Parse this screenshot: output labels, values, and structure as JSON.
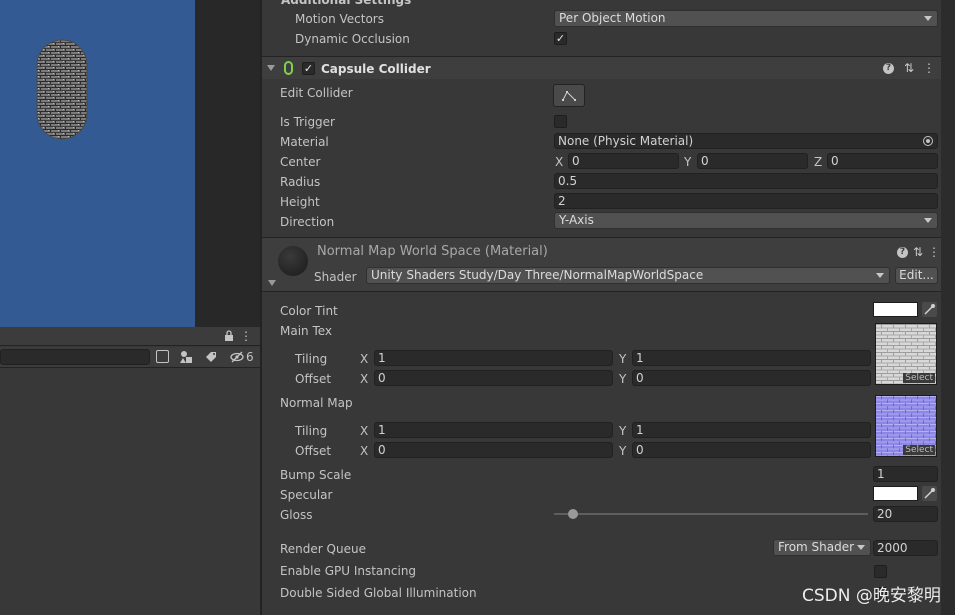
{
  "scene": {
    "bg": "#345a93"
  },
  "hierarchy": {
    "count": "6"
  },
  "additional_settings": {
    "header": "Additional Settings",
    "motion_vectors_label": "Motion Vectors",
    "motion_vectors_value": "Per Object Motion",
    "dynamic_occlusion_label": "Dynamic Occlusion",
    "dynamic_occlusion_checked": "✓"
  },
  "capsule": {
    "title": "Capsule Collider",
    "enabled": "✓",
    "edit_collider_label": "Edit Collider",
    "is_trigger_label": "Is Trigger",
    "material_label": "Material",
    "material_value": "None (Physic Material)",
    "center_label": "Center",
    "center": {
      "x_label": "X",
      "x": "0",
      "y_label": "Y",
      "y": "0",
      "z_label": "Z",
      "z": "0"
    },
    "radius_label": "Radius",
    "radius": "0.5",
    "height_label": "Height",
    "height": "2",
    "direction_label": "Direction",
    "direction": "Y-Axis"
  },
  "material": {
    "name": "Normal Map World Space (Material)",
    "shader_label": "Shader",
    "shader_value": "Unity Shaders Study/Day Three/NormalMapWorldSpace",
    "edit_button": "Edit...",
    "color_tint_label": "Color Tint",
    "main_tex_label": "Main Tex",
    "tiling_label": "Tiling",
    "offset_label": "Offset",
    "x_label": "X",
    "y_label": "Y",
    "main_tiling_x": "1",
    "main_tiling_y": "1",
    "main_offset_x": "0",
    "main_offset_y": "0",
    "select_label": "Select",
    "normal_map_label": "Normal Map",
    "normal_tiling_x": "1",
    "normal_tiling_y": "1",
    "normal_offset_x": "0",
    "normal_offset_y": "0",
    "bump_scale_label": "Bump Scale",
    "bump_scale": "1",
    "specular_label": "Specular",
    "gloss_label": "Gloss",
    "gloss": "20",
    "gloss_slider_fraction": 0.06,
    "render_queue_label": "Render Queue",
    "render_queue_mode": "From Shader",
    "render_queue_value": "2000",
    "gpu_instancing_label": "Enable GPU Instancing",
    "double_sided_gi_label": "Double Sided Global Illumination"
  },
  "watermark": "CSDN @晚安黎明"
}
